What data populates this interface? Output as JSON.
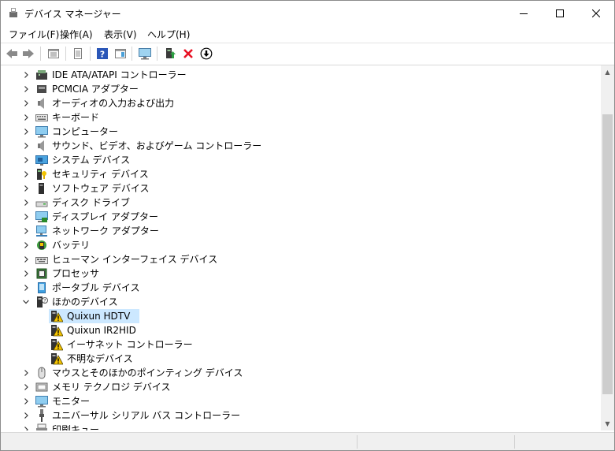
{
  "window": {
    "title": "デバイス マネージャー",
    "minimize_icon": "minimize-icon",
    "maximize_icon": "maximize-icon",
    "close_icon": "close-icon"
  },
  "menu": {
    "items": [
      "ファイル(F)",
      "操作(A)",
      "表示(V)",
      "ヘルプ(H)"
    ]
  },
  "toolbar": {
    "icons": [
      "back-icon",
      "forward-icon",
      "properties-view-icon",
      "driver-details-icon",
      "help-icon",
      "action-pane-icon",
      "monitor-icon",
      "update-driver-icon",
      "uninstall-icon",
      "download-icon"
    ]
  },
  "tree": {
    "items": [
      {
        "label": "IDE ATA/ATAPI コントローラー",
        "icon": "ide-controller-icon",
        "expanded": false,
        "level": 1
      },
      {
        "label": "PCMCIA アダプター",
        "icon": "pcmcia-icon",
        "expanded": false,
        "level": 1
      },
      {
        "label": "オーディオの入力および出力",
        "icon": "speaker-icon",
        "expanded": false,
        "level": 1
      },
      {
        "label": "キーボード",
        "icon": "keyboard-icon",
        "expanded": false,
        "level": 1
      },
      {
        "label": "コンピューター",
        "icon": "computer-icon",
        "expanded": false,
        "level": 1
      },
      {
        "label": "サウンド、ビデオ、およびゲーム コントローラー",
        "icon": "speaker-icon",
        "expanded": false,
        "level": 1
      },
      {
        "label": "システム デバイス",
        "icon": "system-device-icon",
        "expanded": false,
        "level": 1
      },
      {
        "label": "セキュリティ デバイス",
        "icon": "security-device-icon",
        "expanded": false,
        "level": 1
      },
      {
        "label": "ソフトウェア デバイス",
        "icon": "software-device-icon",
        "expanded": false,
        "level": 1
      },
      {
        "label": "ディスク ドライブ",
        "icon": "disk-drive-icon",
        "expanded": false,
        "level": 1
      },
      {
        "label": "ディスプレイ アダプター",
        "icon": "display-adapter-icon",
        "expanded": false,
        "level": 1
      },
      {
        "label": "ネットワーク アダプター",
        "icon": "network-adapter-icon",
        "expanded": false,
        "level": 1
      },
      {
        "label": "バッテリ",
        "icon": "battery-icon",
        "expanded": false,
        "level": 1
      },
      {
        "label": "ヒューマン インターフェイス デバイス",
        "icon": "hid-icon",
        "expanded": false,
        "level": 1
      },
      {
        "label": "プロセッサ",
        "icon": "processor-icon",
        "expanded": false,
        "level": 1
      },
      {
        "label": "ポータブル デバイス",
        "icon": "portable-device-icon",
        "expanded": false,
        "level": 1
      },
      {
        "label": "ほかのデバイス",
        "icon": "other-devices-icon",
        "expanded": true,
        "level": 1
      },
      {
        "label": "Quixun HDTV",
        "icon": "warning-device-icon",
        "level": 2,
        "selected": true
      },
      {
        "label": "Quixun IR2HID",
        "icon": "warning-device-icon",
        "level": 2
      },
      {
        "label": "イーサネット コントローラー",
        "icon": "warning-device-icon",
        "level": 2
      },
      {
        "label": "不明なデバイス",
        "icon": "warning-device-icon",
        "level": 2
      },
      {
        "label": "マウスとそのほかのポインティング デバイス",
        "icon": "mouse-icon",
        "expanded": false,
        "level": 1
      },
      {
        "label": "メモリ テクノロジ デバイス",
        "icon": "memory-device-icon",
        "expanded": false,
        "level": 1
      },
      {
        "label": "モニター",
        "icon": "monitor-icon",
        "expanded": false,
        "level": 1
      },
      {
        "label": "ユニバーサル シリアル バス コントローラー",
        "icon": "usb-icon",
        "expanded": false,
        "level": 1
      },
      {
        "label": "印刷キュー",
        "icon": "print-queue-icon",
        "expanded": false,
        "level": 1
      }
    ]
  },
  "colors": {
    "selection": "#cce8ff",
    "warning": "#f5c400",
    "uninstall_red": "#e81123"
  }
}
